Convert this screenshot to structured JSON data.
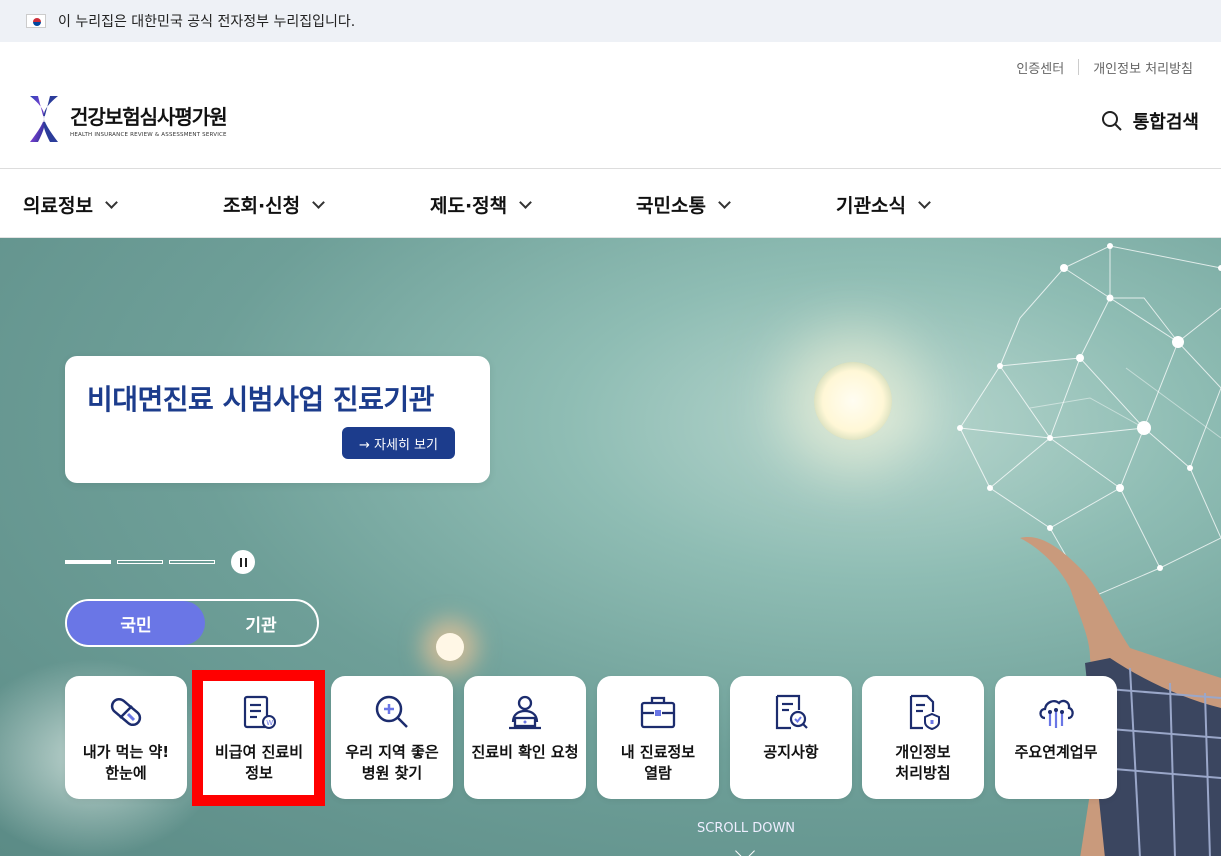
{
  "gov_banner": {
    "text": "이 누리집은 대한민국 공식 전자정부 누리집입니다.",
    "flag_icon": "korea-flag-icon"
  },
  "header": {
    "util_links": [
      "인증센터",
      "개인정보 처리방침"
    ],
    "logo": {
      "name_ko": "건강보험심사평가원",
      "name_en": "HEALTH INSURANCE REVIEW & ASSESSMENT SERVICE"
    },
    "search_label": "통합검색"
  },
  "nav": {
    "items": [
      "의료정보",
      "조회·신청",
      "제도·정책",
      "국민소통",
      "기관소식"
    ]
  },
  "hero": {
    "promo_title": "비대면진료 시범사업 진료기관",
    "promo_button": "→ 자세히 보기",
    "slides_total": 3,
    "slide_active": 1,
    "scroll_text": "SCROLL DOWN"
  },
  "audience_toggle": {
    "options": [
      "국민",
      "기관"
    ],
    "selected": "국민"
  },
  "quick_menu": [
    {
      "label": "내가 먹는 약!\n한눈에",
      "icon": "pill-icon"
    },
    {
      "label": "비급여 진료비\n정보",
      "icon": "fee-document-icon"
    },
    {
      "label": "우리 지역 좋은\n병원 찾기",
      "icon": "search-plus-icon"
    },
    {
      "label": "진료비 확인 요청",
      "icon": "person-laptop-icon"
    },
    {
      "label": "내 진료정보\n열람",
      "icon": "briefcase-icon"
    },
    {
      "label": "공지사항",
      "icon": "document-search-icon"
    },
    {
      "label": "개인정보\n처리방침",
      "icon": "shield-document-icon"
    },
    {
      "label": "주요연계업무",
      "icon": "cloud-link-icon"
    }
  ],
  "colors": {
    "brand_navy": "#1c3c8c",
    "toggle_active": "#6a76e6",
    "highlight": "#ff0000"
  }
}
